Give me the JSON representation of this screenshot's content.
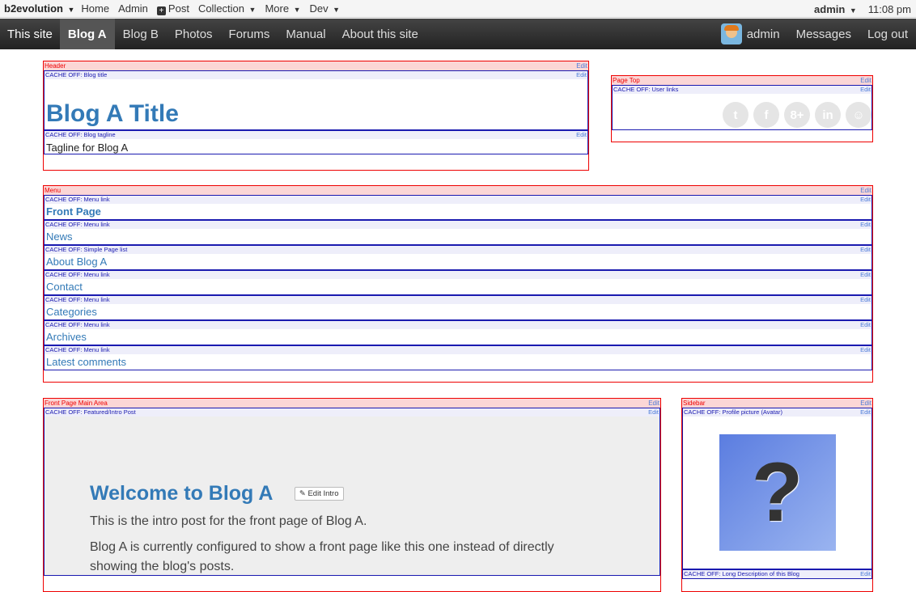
{
  "evobar": {
    "brand": "b2evolution",
    "items": [
      "Home",
      "Admin",
      "Post",
      "Collection",
      "More",
      "Dev"
    ],
    "user": "admin",
    "time": "11:08 pm"
  },
  "sitebar": {
    "this_site": "This site",
    "tabs": [
      "Blog A",
      "Blog B",
      "Photos",
      "Forums",
      "Manual",
      "About this site"
    ],
    "user": "admin",
    "messages": "Messages",
    "logout": "Log out"
  },
  "edit_label": "Edit",
  "header": {
    "label": "Header",
    "title_widget": "CACHE OFF: Blog title",
    "title": "Blog A Title",
    "tagline_widget": "CACHE OFF: Blog tagline",
    "tagline": "Tagline for Blog A"
  },
  "page_top": {
    "label": "Page Top",
    "widget": "CACHE OFF: User links",
    "icons": [
      "twitter-icon",
      "facebook-icon",
      "google-plus-icon",
      "linkedin-icon",
      "github-icon"
    ]
  },
  "menu": {
    "label": "Menu",
    "items": [
      {
        "widget": "CACHE OFF: Menu link",
        "label": "Front Page"
      },
      {
        "widget": "CACHE OFF: Menu link",
        "label": "News"
      },
      {
        "widget": "CACHE OFF: Simple Page list",
        "label": "About Blog A"
      },
      {
        "widget": "CACHE OFF: Menu link",
        "label": "Contact"
      },
      {
        "widget": "CACHE OFF: Menu link",
        "label": "Categories"
      },
      {
        "widget": "CACHE OFF: Menu link",
        "label": "Archives"
      },
      {
        "widget": "CACHE OFF: Menu link",
        "label": "Latest comments"
      }
    ]
  },
  "main": {
    "label": "Front Page Main Area",
    "widget": "CACHE OFF: Featured/Intro Post",
    "heading": "Welcome to Blog A",
    "edit_intro": "Edit Intro",
    "para1": "This is the intro post for the front page of Blog A.",
    "para2": "Blog A is currently configured to show a front page like this one instead of directly showing the blog's posts."
  },
  "sidebar": {
    "label": "Sidebar",
    "widget": "CACHE OFF: Profile picture (Avatar)",
    "widget2": "CACHE OFF: Long Description of this Blog",
    "avatar_glyph": "?"
  }
}
